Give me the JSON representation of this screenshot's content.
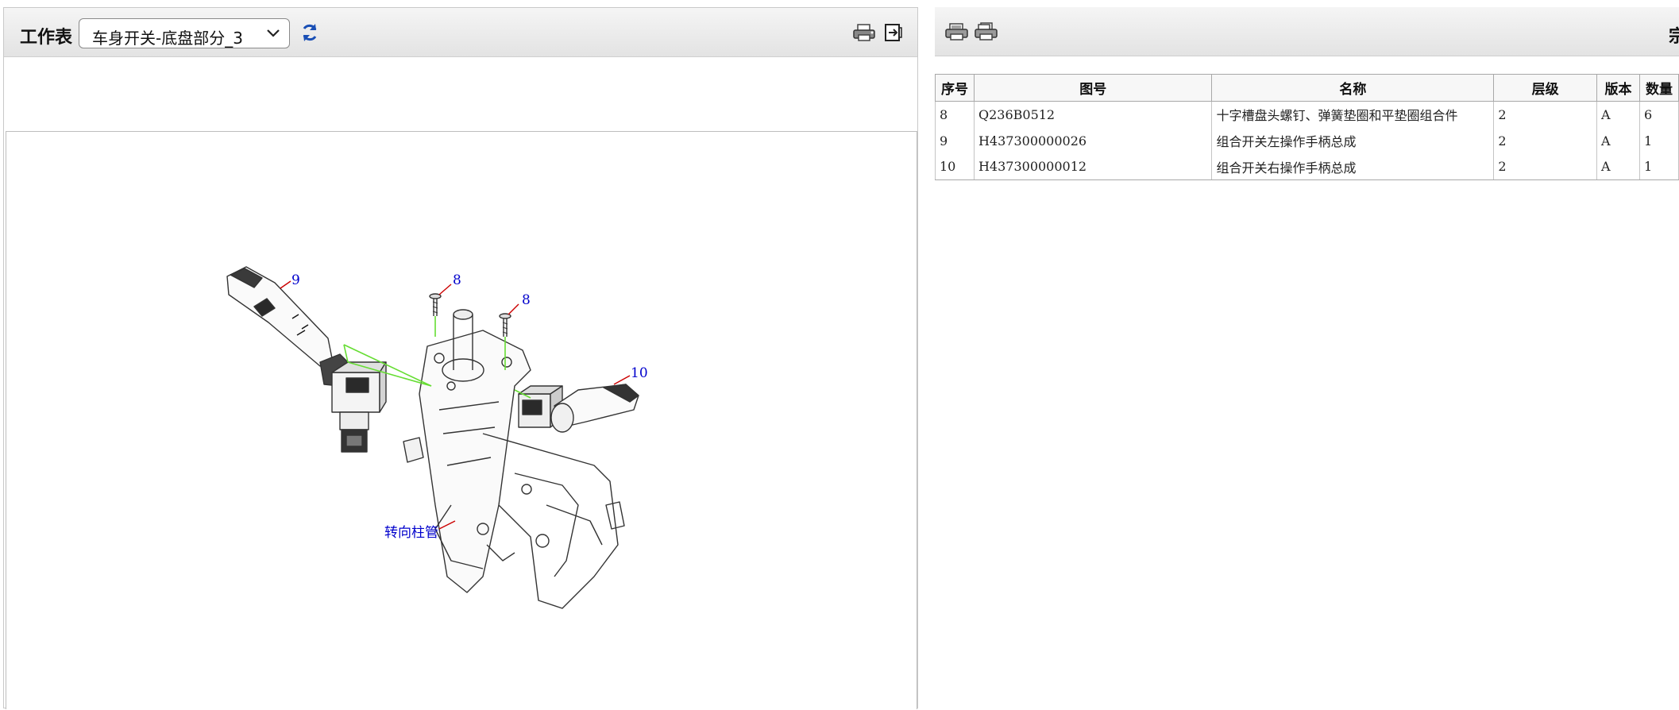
{
  "worksheet": {
    "label": "工作表",
    "selected": "车身开关-底盘部分_3"
  },
  "right_header": {
    "cut_text": "宗"
  },
  "diagram": {
    "callouts": [
      "9",
      "8",
      "8",
      "10"
    ],
    "assembly_label": "转向柱管"
  },
  "table": {
    "headers": [
      "序号",
      "图号",
      "名称",
      "层级",
      "版本",
      "数量"
    ],
    "rows": [
      [
        "8",
        "Q236B0512",
        "十字槽盘头螺钉、弹簧垫圈和平垫圈组合件",
        "2",
        "A",
        "6"
      ],
      [
        "9",
        "H437300000026",
        "组合开关左操作手柄总成",
        "2",
        "A",
        "1"
      ],
      [
        "10",
        "H437300000012",
        "组合开关右操作手柄总成",
        "2",
        "A",
        "1"
      ]
    ]
  },
  "icons": [
    "chevron-down-icon",
    "refresh-icon",
    "printer-icon",
    "exit-icon",
    "print-list-icon",
    "print-all-icon"
  ],
  "colors": {
    "callout_text": "#0000cc",
    "leader_red": "#cc0000",
    "guide_green": "#66dd33",
    "refresh_blue": "#1a4fb5"
  }
}
